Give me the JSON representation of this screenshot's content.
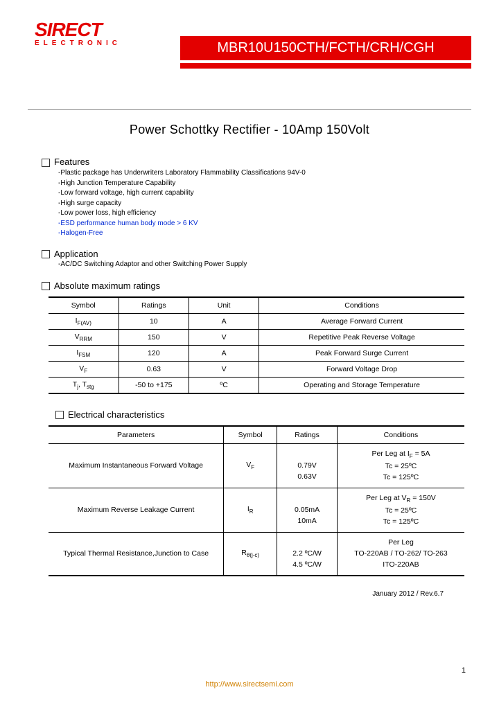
{
  "logo": {
    "main": "SIRECT",
    "sub": "ELECTRONIC"
  },
  "part_number": "MBR10U150CTH/FCTH/CRH/CGH",
  "subtitle": "Power Schottky Rectifier - 10Amp 150Volt",
  "sections": {
    "features": "Features",
    "application": "Application",
    "abs_max": "Absolute maximum ratings",
    "elec": "Electrical characteristics"
  },
  "features": [
    "-Plastic package has Underwriters Laboratory Flammability Classifications 94V-0",
    "-High Junction Temperature Capability",
    "-Low forward voltage, high current capability",
    "-High surge capacity",
    "-Low power loss, high efficiency",
    "-ESD performance human body mode > 6 KV",
    "-Halogen-Free"
  ],
  "application_text": "-AC/DC Switching Adaptor and other Switching Power Supply",
  "abs_table": {
    "headers": [
      "Symbol",
      "Ratings",
      "Unit",
      "Conditions"
    ],
    "rows": [
      {
        "symbol": "IF(AV)",
        "rating": "10",
        "unit": "A",
        "cond": "Average Forward Current"
      },
      {
        "symbol": "VRRM",
        "rating": "150",
        "unit": "V",
        "cond": "Repetitive Peak Reverse Voltage"
      },
      {
        "symbol": "IFSM",
        "rating": "120",
        "unit": "A",
        "cond": "Peak Forward Surge Current"
      },
      {
        "symbol": "VF",
        "rating": "0.63",
        "unit": "V",
        "cond": "Forward Voltage Drop"
      },
      {
        "symbol": "Tj, Tstg",
        "rating": "-50 to +175",
        "unit": "ºC",
        "cond": "Operating and Storage Temperature"
      }
    ]
  },
  "elec_table": {
    "headers": [
      "Parameters",
      "Symbol",
      "Ratings",
      "Conditions"
    ],
    "rows": [
      {
        "param": "Maximum Instantaneous Forward Voltage",
        "symbol": "VF",
        "ratings": "0.79V\n0.63V",
        "cond": "Per Leg at IF = 5A\nTc = 25ºC\nTc = 125ºC"
      },
      {
        "param": "Maximum Reverse Leakage Current",
        "symbol": "IR",
        "ratings": "0.05mA\n10mA",
        "cond": "Per Leg at VR = 150V\nTc = 25ºC\nTc = 125ºC"
      },
      {
        "param": "Typical Thermal Resistance,Junction to Case",
        "symbol": "Rθ(j-c)",
        "ratings": "2.2 ºC/W\n4.5 ºC/W",
        "cond": "Per Leg\nTO-220AB / TO-262/ TO-263\nITO-220AB"
      }
    ]
  },
  "revision": "January 2012 / Rev.6.7",
  "page_number": "1",
  "footer_url": "http://www.sirectsemi.com"
}
